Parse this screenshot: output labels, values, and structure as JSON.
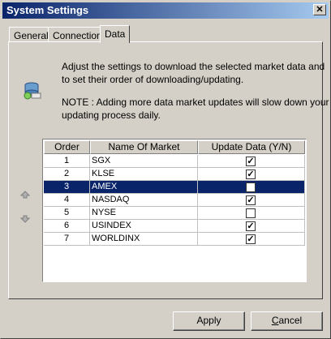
{
  "window": {
    "title": "System Settings",
    "close_glyph": "✕"
  },
  "tabs": [
    {
      "label": "General",
      "active": false
    },
    {
      "label": "Connection",
      "active": false
    },
    {
      "label": "Data",
      "active": true
    }
  ],
  "description": {
    "line1": "Adjust the settings to download the selected market data and",
    "line2": "to set their order of downloading/updating.",
    "note1": "NOTE : Adding more data market updates will slow down your",
    "note2": "updating process daily."
  },
  "table": {
    "headers": {
      "order": "Order",
      "name": "Name Of Market",
      "update": "Update Data (Y/N)"
    },
    "rows": [
      {
        "order": "1",
        "name": "SGX",
        "checked": true,
        "selected": false
      },
      {
        "order": "2",
        "name": "KLSE",
        "checked": true,
        "selected": false
      },
      {
        "order": "3",
        "name": "AMEX",
        "checked": false,
        "selected": true
      },
      {
        "order": "4",
        "name": "NASDAQ",
        "checked": true,
        "selected": false
      },
      {
        "order": "5",
        "name": "NYSE",
        "checked": false,
        "selected": false
      },
      {
        "order": "6",
        "name": "USINDEX",
        "checked": true,
        "selected": false
      },
      {
        "order": "7",
        "name": "WORLDINX",
        "checked": true,
        "selected": false
      }
    ]
  },
  "icons": {
    "database": "database-icon",
    "up": "move-up-arrow-icon",
    "down": "move-down-arrow-icon"
  },
  "buttons": {
    "apply": "Apply",
    "cancel_prefix": "C",
    "cancel_rest": "ancel"
  },
  "colors": {
    "selection": "#0a246a",
    "titlebar": "#0a246a",
    "face": "#d4d0c8"
  }
}
